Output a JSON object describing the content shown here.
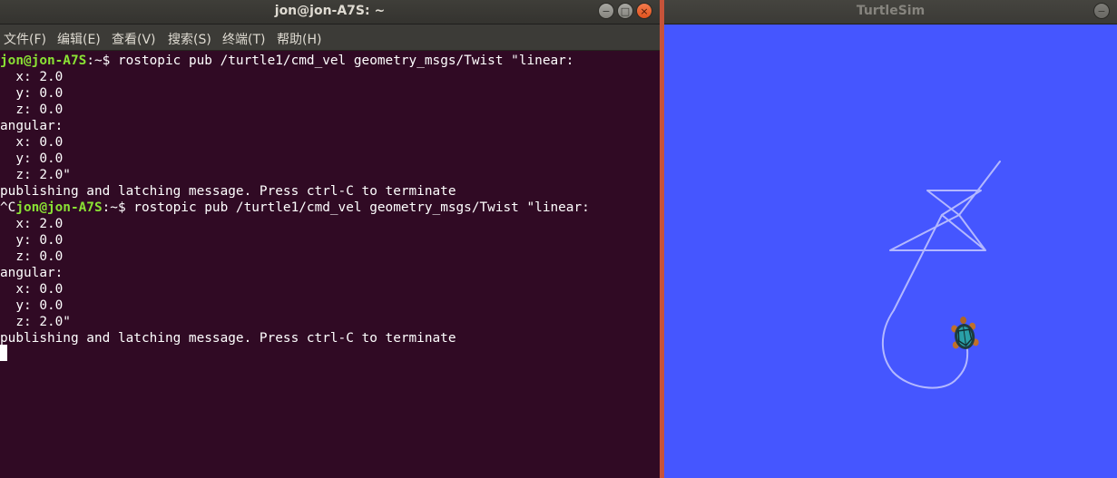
{
  "terminal": {
    "title": "jon@jon-A7S: ~",
    "menu": [
      "文件(F)",
      "编辑(E)",
      "查看(V)",
      "搜索(S)",
      "终端(T)",
      "帮助(H)"
    ],
    "lines": [
      {
        "pre": "",
        "prompt": "jon@jon-A7S",
        "post": ":~$ rostopic pub /turtle1/cmd_vel geometry_msgs/Twist \"linear:"
      },
      {
        "pre": "  x: 2.0",
        "prompt": "",
        "post": ""
      },
      {
        "pre": "  y: 0.0",
        "prompt": "",
        "post": ""
      },
      {
        "pre": "  z: 0.0",
        "prompt": "",
        "post": ""
      },
      {
        "pre": "angular:",
        "prompt": "",
        "post": ""
      },
      {
        "pre": "  x: 0.0",
        "prompt": "",
        "post": ""
      },
      {
        "pre": "  y: 0.0",
        "prompt": "",
        "post": ""
      },
      {
        "pre": "  z: 2.0\"",
        "prompt": "",
        "post": ""
      },
      {
        "pre": "publishing and latching message. Press ctrl-C to terminate",
        "prompt": "",
        "post": ""
      },
      {
        "pre": "^C",
        "prompt": "jon@jon-A7S",
        "post": ":~$ rostopic pub /turtle1/cmd_vel geometry_msgs/Twist \"linear:"
      },
      {
        "pre": "  x: 2.0",
        "prompt": "",
        "post": ""
      },
      {
        "pre": "  y: 0.0",
        "prompt": "",
        "post": ""
      },
      {
        "pre": "  z: 0.0",
        "prompt": "",
        "post": ""
      },
      {
        "pre": "angular:",
        "prompt": "",
        "post": ""
      },
      {
        "pre": "  x: 0.0",
        "prompt": "",
        "post": ""
      },
      {
        "pre": "  y: 0.0",
        "prompt": "",
        "post": ""
      },
      {
        "pre": "  z: 2.0\"",
        "prompt": "",
        "post": ""
      },
      {
        "pre": "publishing and latching message. Press ctrl-C to terminate",
        "prompt": "",
        "post": ""
      }
    ],
    "window_buttons": [
      "−",
      "□",
      "×"
    ],
    "colors": {
      "background": "#300a24",
      "prompt": "#8ae234",
      "text": "#ffffff"
    }
  },
  "turtlesim": {
    "title": "TurtleSim",
    "window_buttons": [
      "−"
    ],
    "colors": {
      "background": "#4556ff",
      "trail": "#b3b8ff"
    },
    "icons": {
      "turtle": "turtle-icon"
    }
  }
}
